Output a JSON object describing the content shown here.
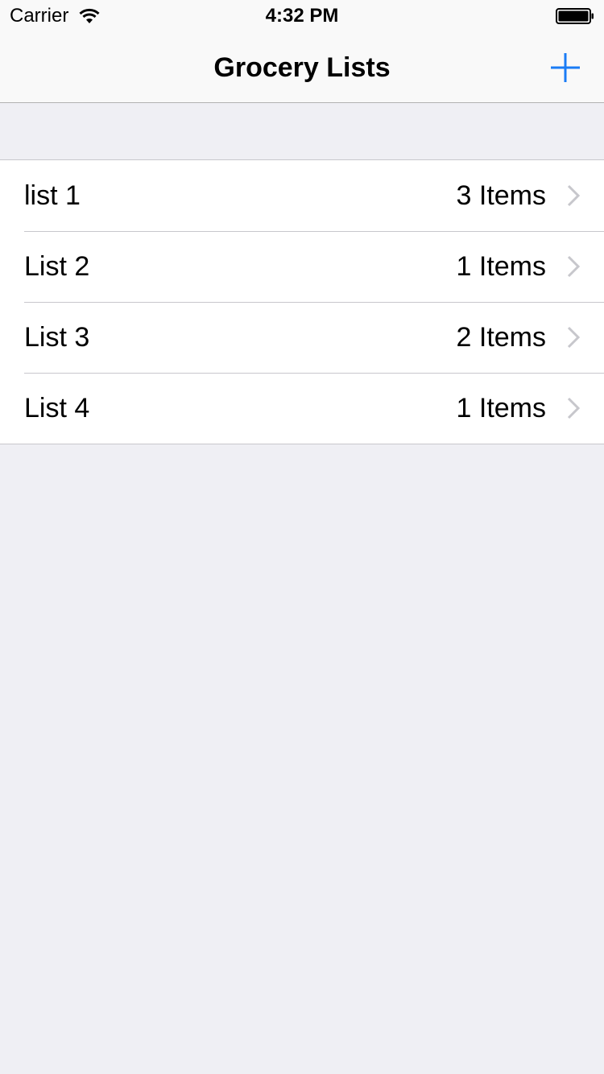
{
  "status_bar": {
    "carrier": "Carrier",
    "time": "4:32 PM"
  },
  "nav_bar": {
    "title": "Grocery Lists",
    "add_icon": "plus-icon",
    "accent_color": "#1a7cf5"
  },
  "lists": [
    {
      "name": "list 1",
      "detail": "3 Items"
    },
    {
      "name": "List 2",
      "detail": "1 Items"
    },
    {
      "name": "List 3",
      "detail": "2 Items"
    },
    {
      "name": "List 4",
      "detail": "1 Items"
    }
  ]
}
